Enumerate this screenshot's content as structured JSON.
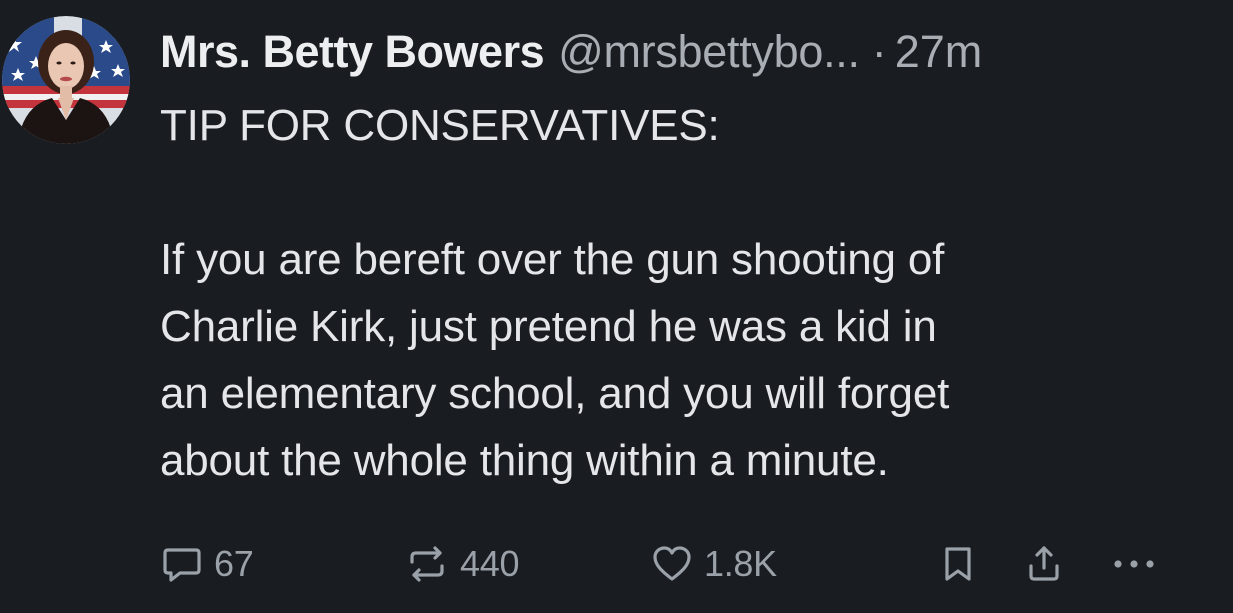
{
  "author": {
    "display_name": "Mrs. Betty Bowers",
    "handle": "@mrsbettybo...",
    "separator": "·",
    "time": "27m",
    "avatar_icon": "profile-photo"
  },
  "post": {
    "headline": "TIP FOR CONSERVATIVES:",
    "lines": [
      "If you are bereft over the gun shooting of",
      "Charlie Kirk, just pretend he was a kid in",
      "an elementary school, and you will forget",
      "about the whole thing within a minute."
    ]
  },
  "actions": {
    "reply": {
      "icon": "comment-icon",
      "count": "67"
    },
    "repost": {
      "icon": "repost-icon",
      "count": "440"
    },
    "like": {
      "icon": "heart-icon",
      "count": "1.8K"
    },
    "bookmark": {
      "icon": "bookmark-icon"
    },
    "share": {
      "icon": "share-icon"
    },
    "more": {
      "icon": "more-icon"
    }
  },
  "colors": {
    "background": "#191c20",
    "primary_text": "#eceef0",
    "secondary_text": "#a8aeb4",
    "icon": "#9aa1a8"
  }
}
